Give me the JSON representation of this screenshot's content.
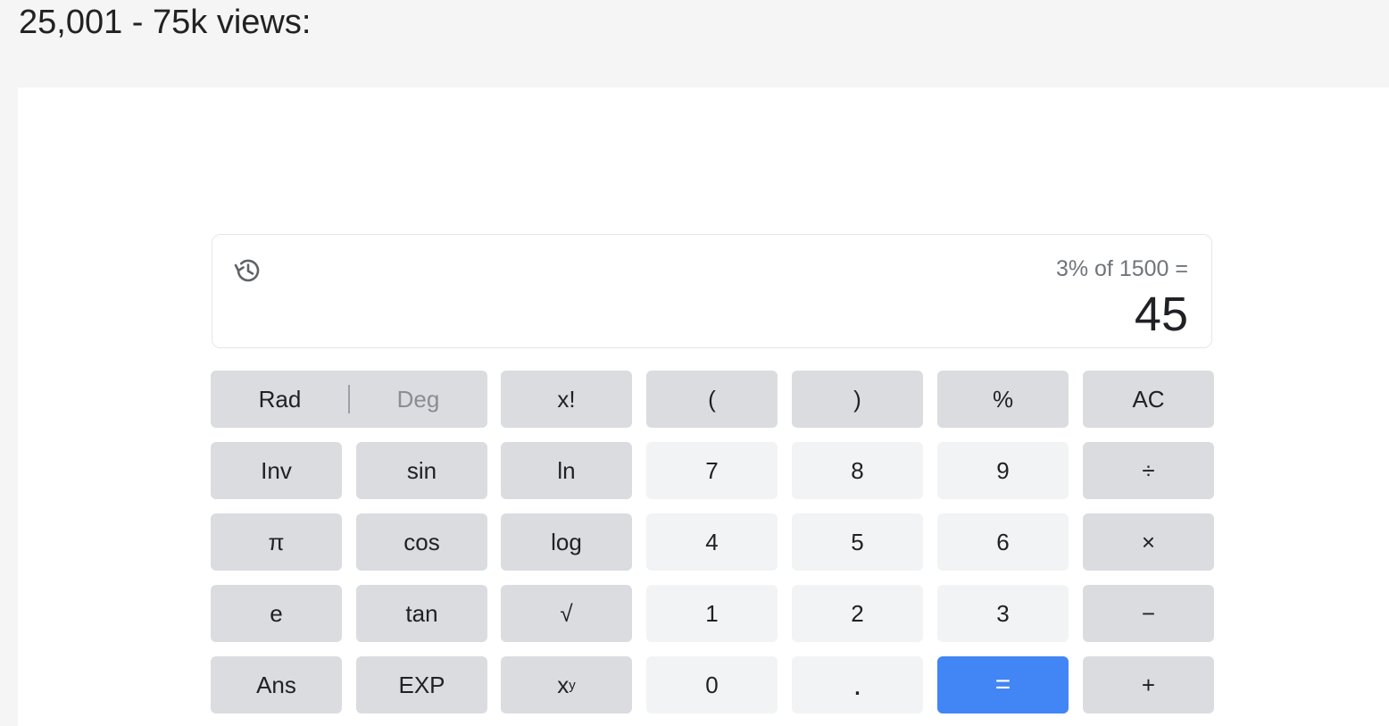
{
  "page": {
    "heading": "25,001 - 75k views:"
  },
  "calculator": {
    "history_icon": "history-icon",
    "expression": "3% of 1500 =",
    "result": "45",
    "mode": {
      "rad_label": "Rad",
      "deg_label": "Deg",
      "selected": "Rad"
    },
    "keys": {
      "factorial": "x!",
      "open_paren": "(",
      "close_paren": ")",
      "percent": "%",
      "clear": "AC",
      "inv": "Inv",
      "sin": "sin",
      "ln": "ln",
      "seven": "7",
      "eight": "8",
      "nine": "9",
      "divide": "÷",
      "pi": "π",
      "cos": "cos",
      "log": "log",
      "four": "4",
      "five": "5",
      "six": "6",
      "multiply": "×",
      "e": "e",
      "tan": "tan",
      "sqrt": "√",
      "one": "1",
      "two": "2",
      "three": "3",
      "minus": "−",
      "ans": "Ans",
      "exp": "EXP",
      "power_base": "x",
      "power_exp": "y",
      "zero": "0",
      "dot": ".",
      "equals": "=",
      "plus": "+"
    },
    "colors": {
      "function_key": "#dadce0",
      "number_key": "#f1f3f4",
      "equals_key": "#4285f4"
    }
  }
}
